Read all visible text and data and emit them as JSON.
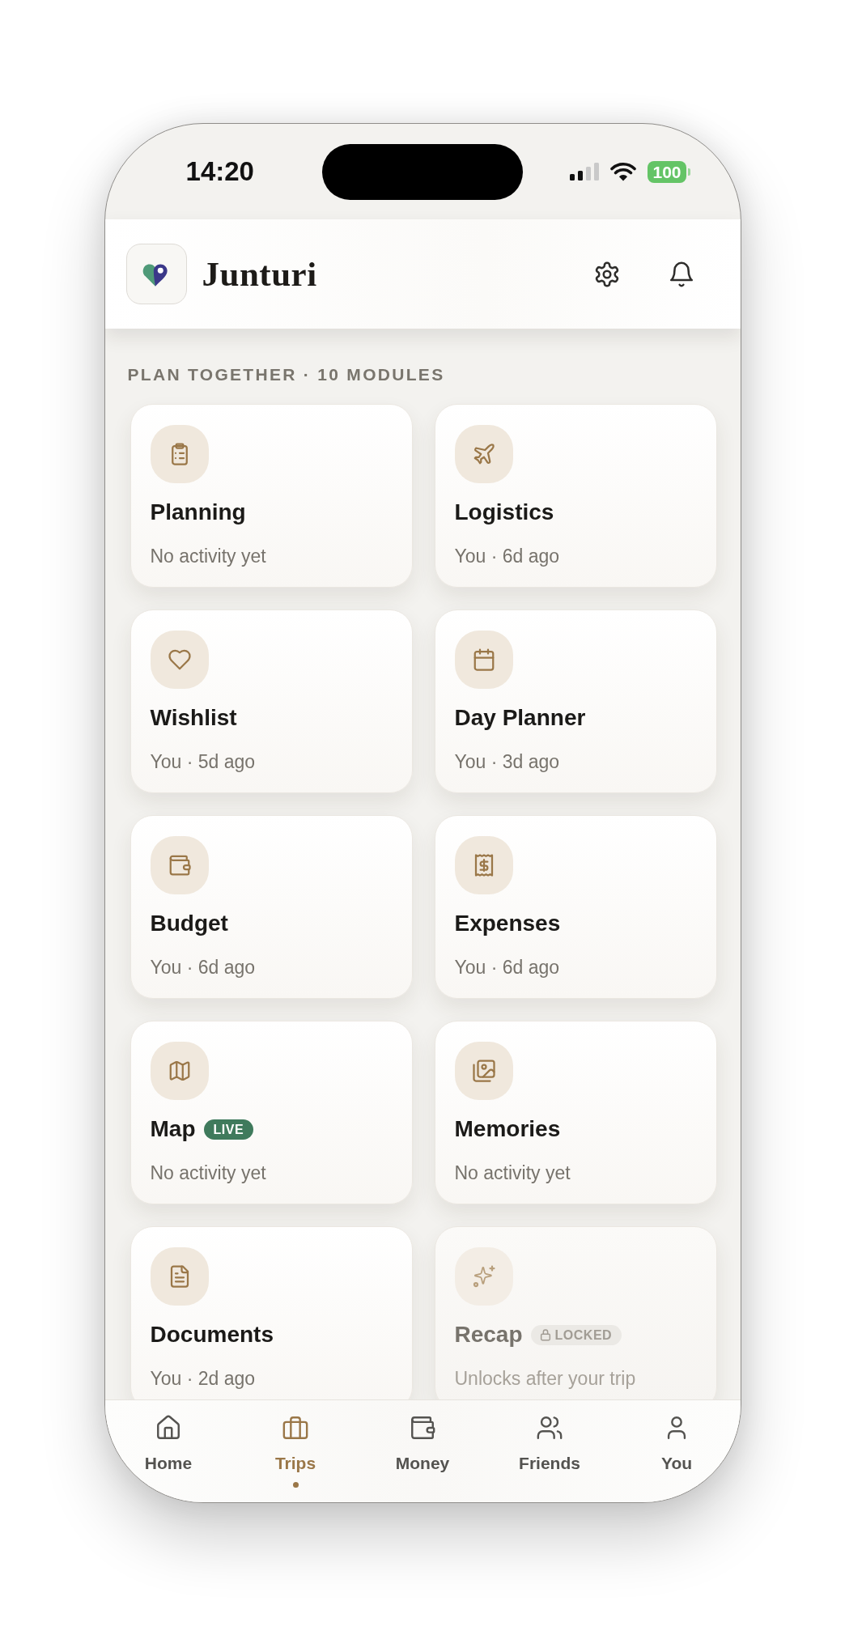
{
  "status_bar": {
    "time": "14:20",
    "battery": "100"
  },
  "header": {
    "title": "Junturi"
  },
  "section": {
    "heading": "PLAN TOGETHER · 10 MODULES"
  },
  "modules": [
    {
      "title": "Planning",
      "subtitle": "No activity yet",
      "locked": false
    },
    {
      "title": "Logistics",
      "subtitle": "You · 6d ago",
      "locked": false
    },
    {
      "title": "Wishlist",
      "subtitle": "You · 5d ago",
      "locked": false
    },
    {
      "title": "Day Planner",
      "subtitle": "You · 3d ago",
      "locked": false
    },
    {
      "title": "Budget",
      "subtitle": "You · 6d ago",
      "locked": false
    },
    {
      "title": "Expenses",
      "subtitle": "You · 6d ago",
      "locked": false
    },
    {
      "title": "Map",
      "subtitle": "No activity yet",
      "locked": false,
      "badge": {
        "kind": "live",
        "text": "LIVE"
      }
    },
    {
      "title": "Memories",
      "subtitle": "No activity yet",
      "locked": false
    },
    {
      "title": "Documents",
      "subtitle": "You · 2d ago",
      "locked": false
    },
    {
      "title": "Recap",
      "subtitle": "Unlocks after your trip",
      "locked": true,
      "badge": {
        "kind": "locked",
        "text": "LOCKED"
      }
    }
  ],
  "tab_bar": [
    {
      "label": "Home",
      "selected": false
    },
    {
      "label": "Trips",
      "selected": true
    },
    {
      "label": "Money",
      "selected": false
    },
    {
      "label": "Friends",
      "selected": false
    },
    {
      "label": "You",
      "selected": false
    }
  ]
}
